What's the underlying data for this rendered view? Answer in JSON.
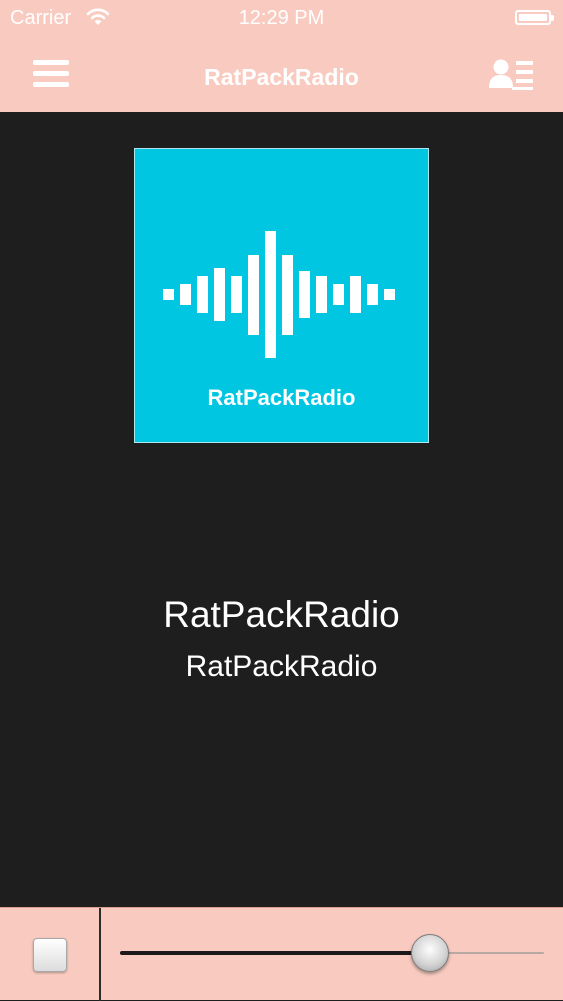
{
  "status_bar": {
    "carrier": "Carrier",
    "time": "12:29 PM",
    "icons": [
      "wifi-icon",
      "battery-icon"
    ]
  },
  "nav": {
    "title": "RatPackRadio",
    "left_icon": "hamburger-menu-icon",
    "right_icon": "profile-list-icon"
  },
  "artwork": {
    "label": "RatPackRadio",
    "background": "#00c6e2",
    "icon": "sound-wave-icon"
  },
  "now_playing": {
    "station": "RatPackRadio",
    "subtitle": "RatPackRadio"
  },
  "player": {
    "stop_icon": "stop-icon",
    "volume": 0.73
  },
  "colors": {
    "bar_background": "#f9cbc0",
    "content_background": "#1f1e1f",
    "artwork_background": "#00c6e2"
  }
}
